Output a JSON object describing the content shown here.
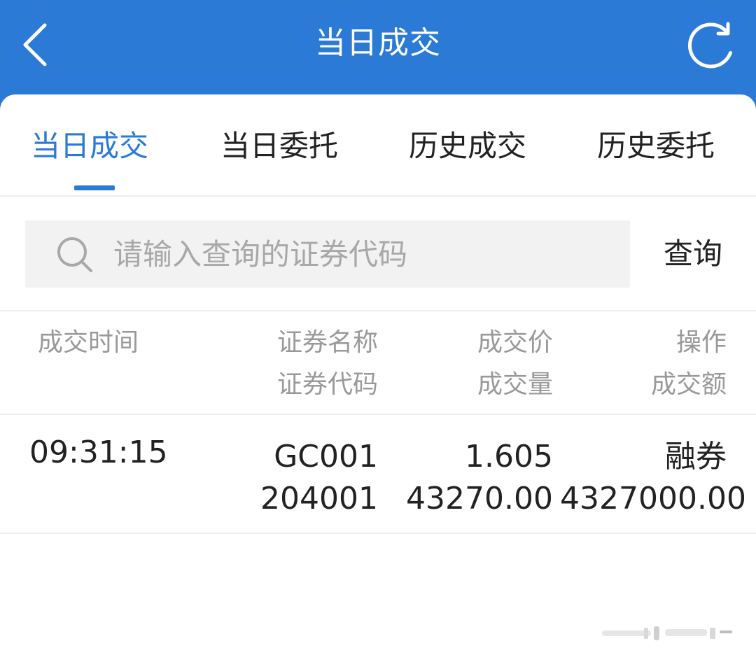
{
  "header": {
    "title": "当日成交",
    "back_icon": "chevron-left-icon",
    "refresh_icon": "refresh-icon"
  },
  "tabs": [
    {
      "label": "当日成交",
      "active": true
    },
    {
      "label": "当日委托",
      "active": false
    },
    {
      "label": "历史成交",
      "active": false
    },
    {
      "label": "历史委托",
      "active": false
    }
  ],
  "search": {
    "placeholder": "请输入查询的证券代码",
    "value": "",
    "icon": "search-icon",
    "button_label": "查询"
  },
  "table": {
    "headers": {
      "time": "成交时间",
      "name": "证券名称",
      "code": "证券代码",
      "price": "成交价",
      "volume": "成交量",
      "operation": "操作",
      "amount": "成交额"
    },
    "rows": [
      {
        "time": "09:31:15",
        "name": "GC001",
        "code": "204001",
        "price": "1.605",
        "volume": "43270.00",
        "operation": "融券",
        "amount": "4327000.00"
      }
    ]
  },
  "colors": {
    "accent": "#2b7ad6",
    "text": "#222222",
    "muted": "#999999",
    "placeholder": "#a8a8a8",
    "search_bg": "#f2f2f2"
  }
}
